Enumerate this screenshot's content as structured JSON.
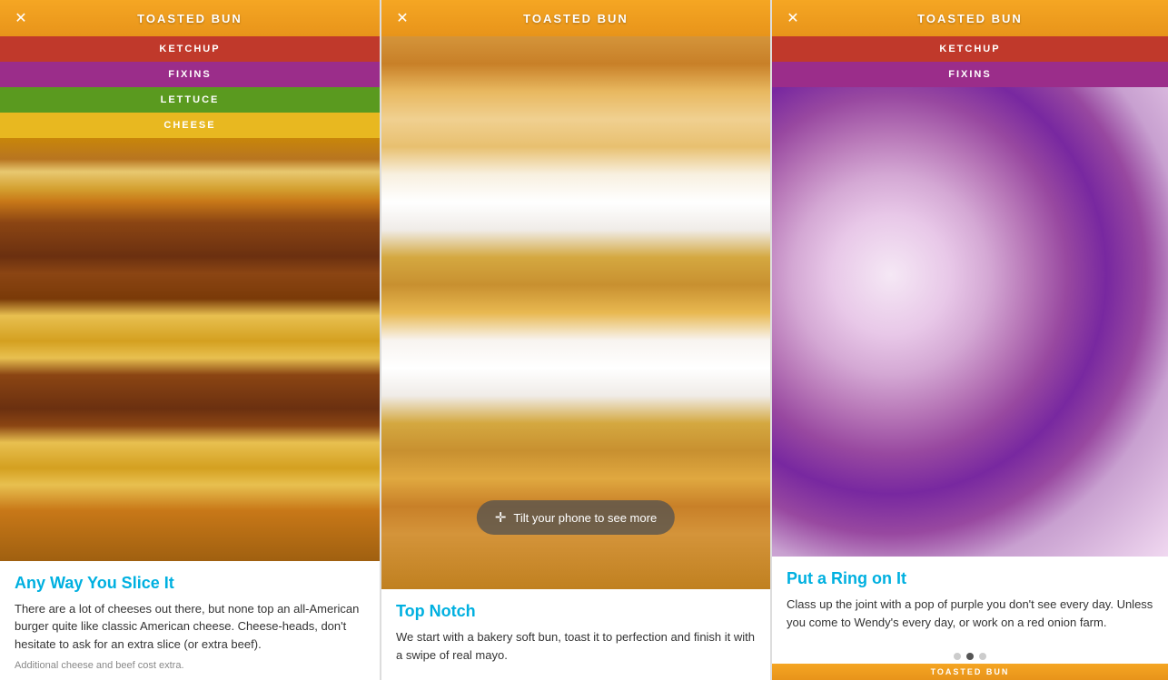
{
  "panels": [
    {
      "id": "panel-left",
      "header": {
        "title": "TOASTED BUN",
        "close_label": "✕"
      },
      "layers": [
        {
          "label": "KETCHUP",
          "class": "bar-ketchup"
        },
        {
          "label": "FIXINS",
          "class": "bar-fixins"
        },
        {
          "label": "LETTUCE",
          "class": "bar-lettuce"
        },
        {
          "label": "CHEESE",
          "class": "bar-cheese"
        }
      ],
      "image_type": "burger",
      "article": {
        "title": "Any Way You Slice It",
        "body": "There are a lot of cheeses out there, but none top an all-American burger quite like classic American cheese. Cheese-heads, don't hesitate to ask for an extra slice (or extra beef).",
        "footnote": "Additional cheese and beef cost extra."
      }
    },
    {
      "id": "panel-center",
      "header": {
        "title": "TOASTED BUN",
        "close_label": "✕"
      },
      "layers": [],
      "image_type": "bun",
      "tilt_overlay": "Tilt your phone to see more",
      "article": {
        "title": "Top Notch",
        "body": "We start with a bakery soft bun, toast it to perfection and finish it with a swipe of real mayo.",
        "footnote": ""
      }
    },
    {
      "id": "panel-right",
      "header": {
        "title": "TOASTED BUN",
        "close_label": "✕"
      },
      "layers": [
        {
          "label": "KETCHUP",
          "class": "bar-ketchup"
        },
        {
          "label": "FIXINS",
          "class": "bar-fixins"
        }
      ],
      "image_type": "onion",
      "article": {
        "title": "Put a Ring on It",
        "body": "Class up the joint with a pop of purple you don't see every day. Unless you come to Wendy's every day, or work on a red onion farm.",
        "footnote": ""
      },
      "pagination": {
        "dots": 3,
        "active": 1
      }
    }
  ],
  "bottom_strip_label": "TOASTED BUN"
}
